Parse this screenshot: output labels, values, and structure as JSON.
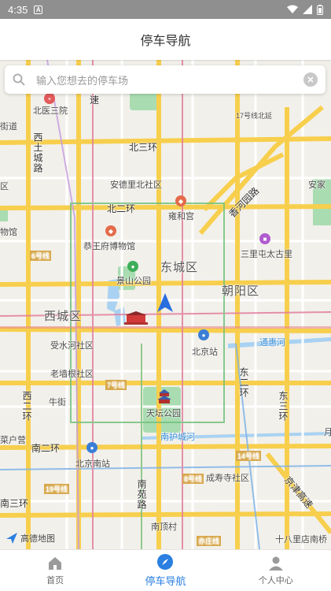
{
  "status_bar": {
    "time": "4:35",
    "notification_glyph": "A"
  },
  "header": {
    "title": "停车导航"
  },
  "search": {
    "placeholder": "输入您想去的停车场"
  },
  "map": {
    "provider_logo": "高德地图",
    "labels": {
      "beiyisanyuan": "北医三院",
      "jiedao": "街道",
      "su": "速",
      "jingcheng": "17号线北延",
      "beisanhuan": "北三环",
      "xitucheng": "西土城路",
      "anzhenbeili": "安德里北社区",
      "anjia": "安家",
      "qu": "区",
      "beierhuan": "北二环",
      "yonghegong": "雍和宫",
      "xiangheyuan": "香河园路",
      "bowuguan": "物馆",
      "gongwangfu": "恭王府博物馆",
      "sanlitun": "三里屯太古里",
      "line6": "6号线",
      "jingshan": "景山公园",
      "dongcheng": "东城区",
      "chaoyang": "朝阳区",
      "xicheng": "西城区",
      "shoushuihe": "受水河社区",
      "beijingzhan": "北京站",
      "tonghuihe": "通惠河",
      "laoqianggen": "老墙根社区",
      "line7": "7号线",
      "dongerhuan": "东二环",
      "dongsanhuan": "东三环",
      "xierhuan": "西二环",
      "niujie": "牛街",
      "tiantan": "天坛公园",
      "caihuying": "菜户营",
      "nanhuchenghe": "南护城河",
      "nanerhuan": "南二环",
      "beijingnan": "北京南站",
      "line14": "14号线",
      "line8": "8号线",
      "chengshousi": "成寿寺社区",
      "line19": "19号线",
      "nanyuan": "南苑路",
      "nansanhuan": "南三环",
      "jingjin": "京津高速",
      "nandingcun": "南顶村",
      "yizhuang": "亦庄线",
      "shibalidian": "十八里店南桥",
      "yue": "月"
    }
  },
  "tabs": [
    {
      "label": "首页",
      "icon": "home-icon"
    },
    {
      "label": "停车导航",
      "icon": "compass-icon"
    },
    {
      "label": "个人中心",
      "icon": "user-icon"
    }
  ],
  "colors": {
    "accent": "#2a7fe0",
    "map_bg": "#f2f0ea",
    "road_major": "#f7cf4d",
    "park": "#a9dcb1",
    "water": "#a9d2f2",
    "status_bar": "#8f8f8f"
  }
}
